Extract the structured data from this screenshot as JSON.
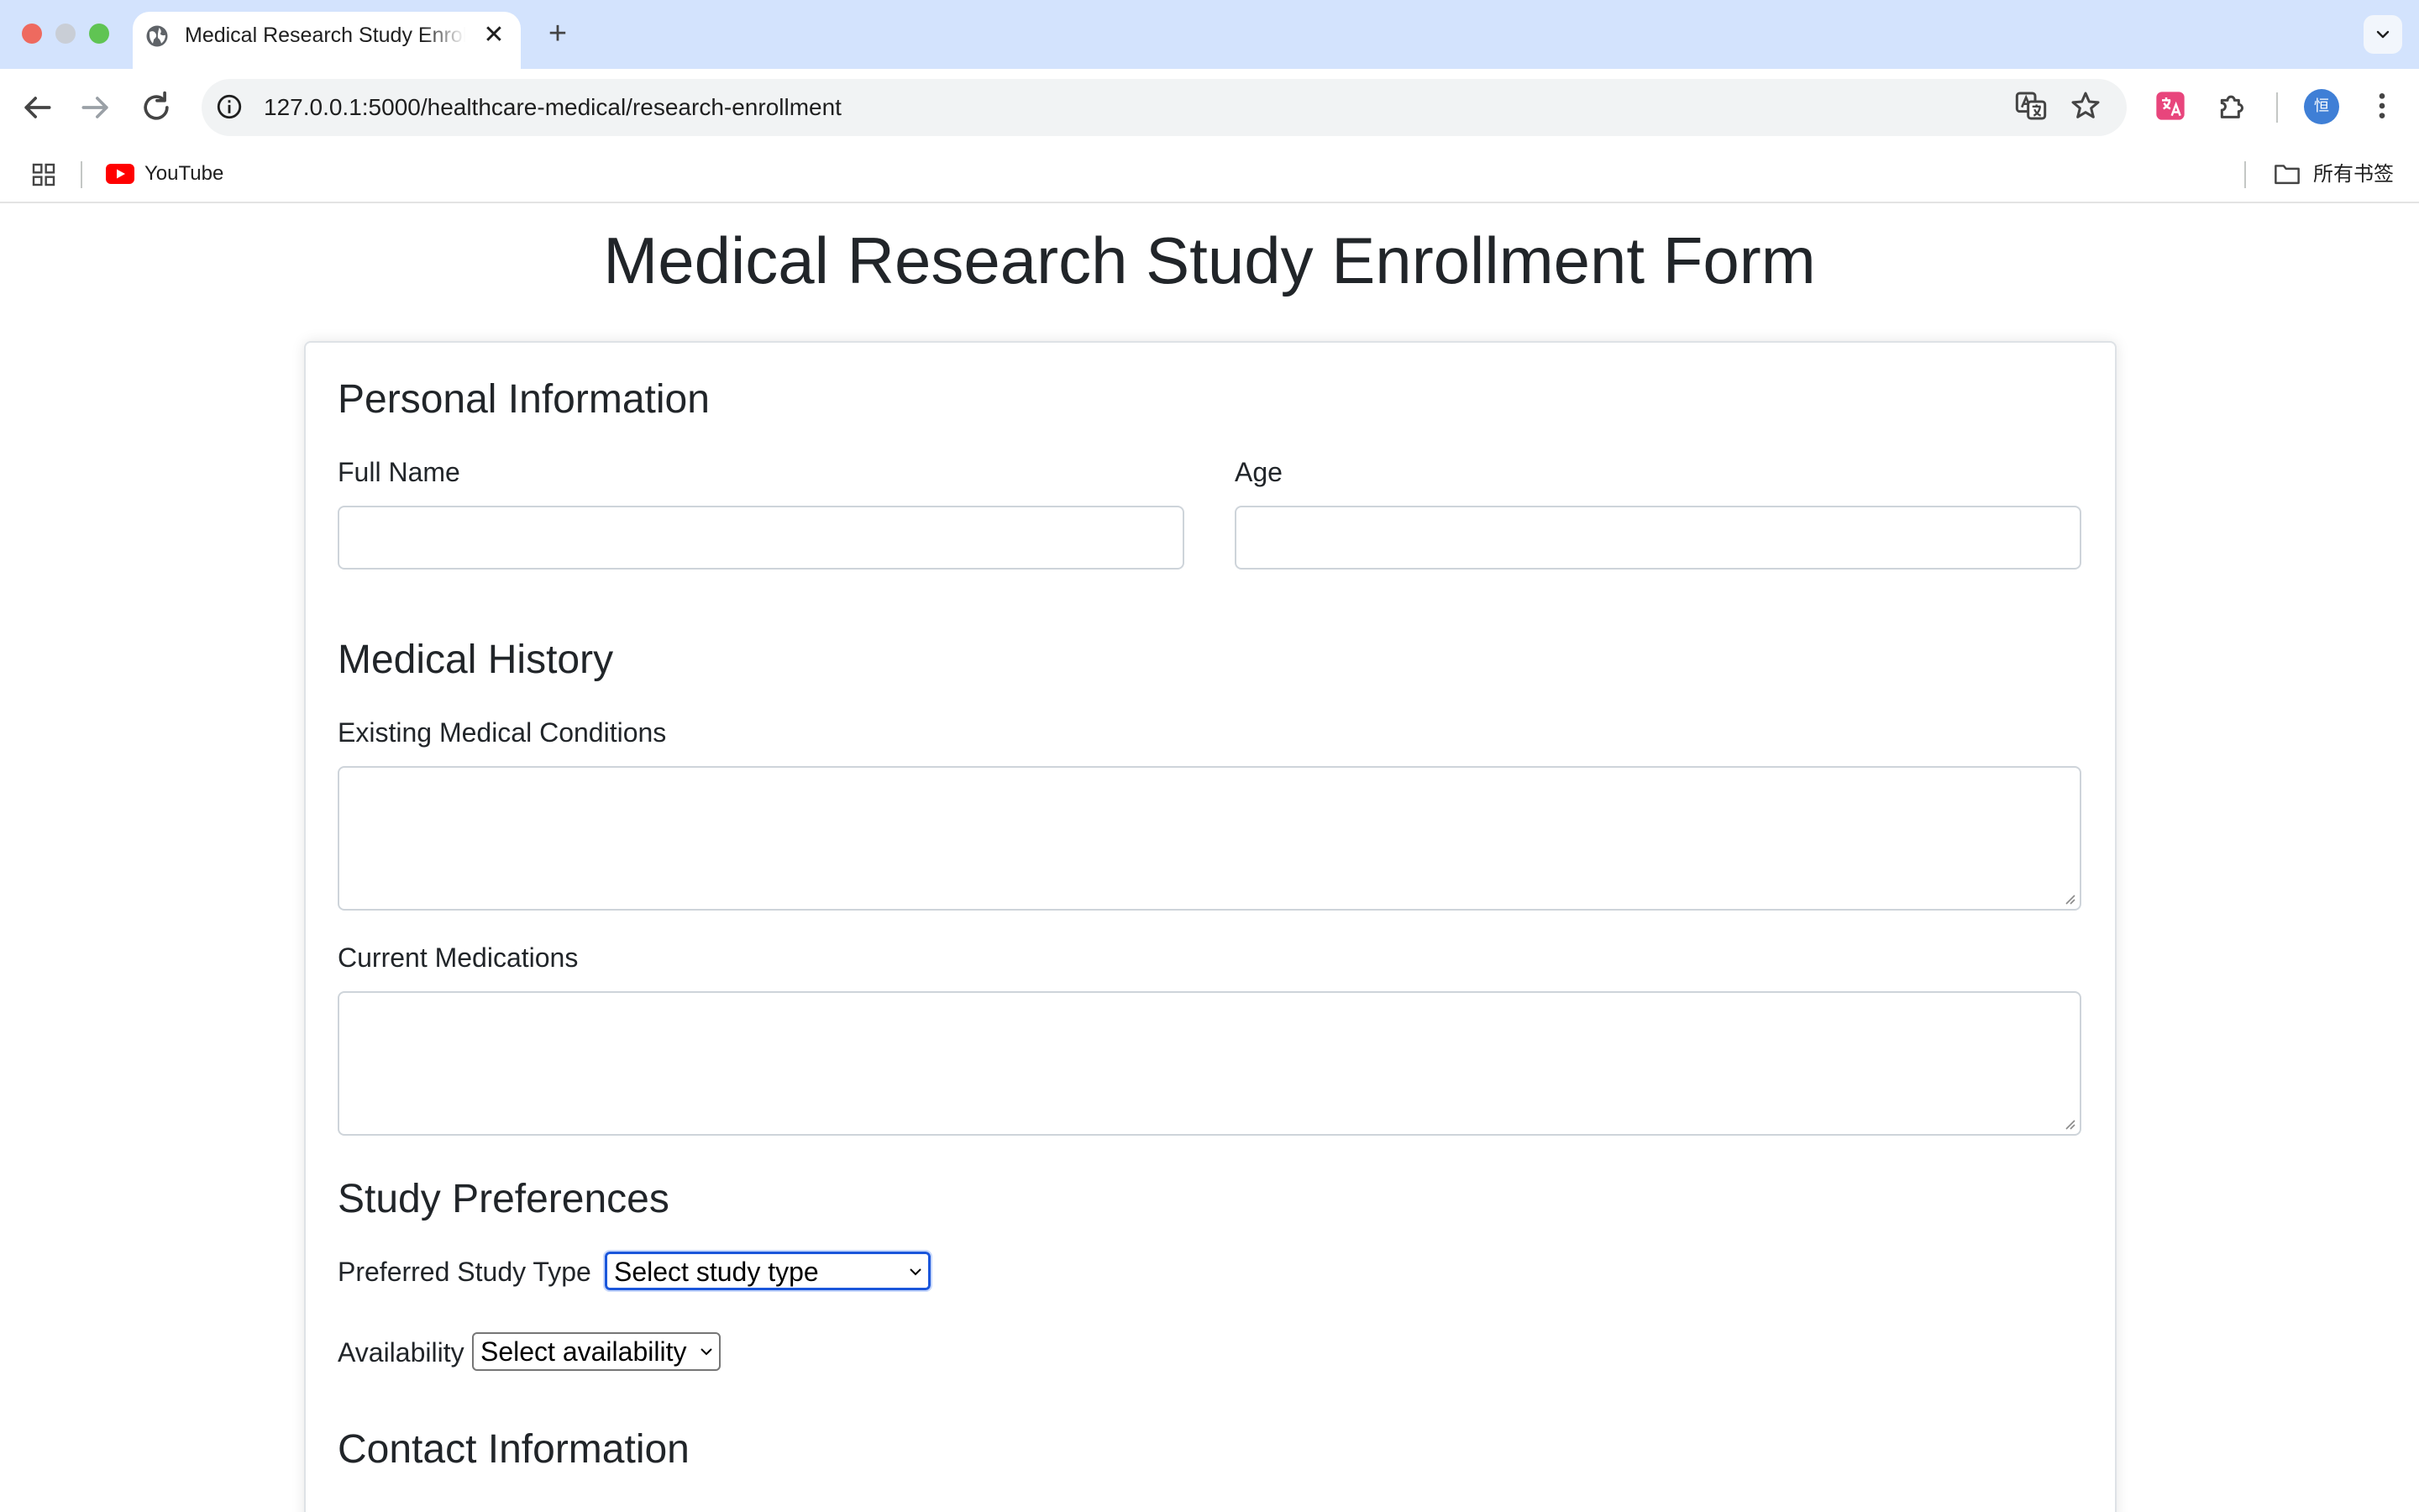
{
  "browser": {
    "tab_title": "Medical Research Study Enrollment Form",
    "new_tab_symbol": "+",
    "close_symbol": "✕",
    "url": "127.0.0.1:5000/healthcare-medical/research-enrollment",
    "bookmarks": {
      "youtube_label": "YouTube",
      "all_bookmarks_label": "所有书签"
    },
    "profile_initial": "恒",
    "colors": {
      "titlebar": "#d3e3fd",
      "accent": "#1a56db",
      "youtube_red": "#ff0000"
    }
  },
  "page": {
    "title": "Medical Research Study Enrollment Form",
    "sections": {
      "personal": {
        "title": "Personal Information",
        "full_name_label": "Full Name",
        "full_name_value": "",
        "age_label": "Age",
        "age_value": ""
      },
      "medical": {
        "title": "Medical History",
        "conditions_label": "Existing Medical Conditions",
        "conditions_value": "",
        "medications_label": "Current Medications",
        "medications_value": ""
      },
      "study": {
        "title": "Study Preferences",
        "study_type_label": "Preferred Study Type",
        "study_type_selected": "Select study type",
        "availability_label": "Availability",
        "availability_selected": "Select availability"
      },
      "contact": {
        "title": "Contact Information"
      }
    }
  }
}
